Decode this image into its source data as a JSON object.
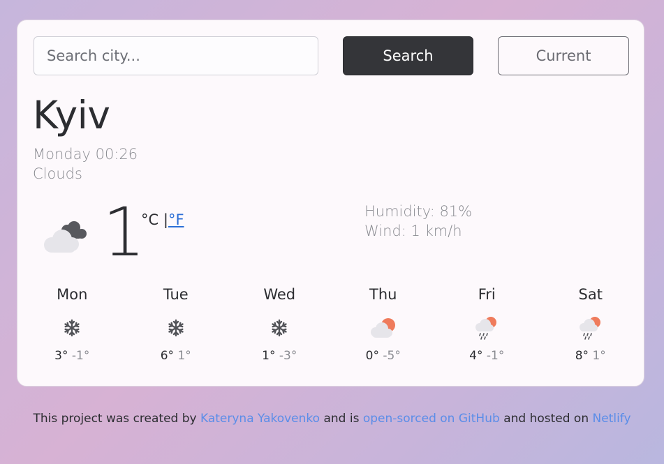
{
  "search": {
    "placeholder": "Search city...",
    "button_label": "Search",
    "current_label": "Current"
  },
  "weather": {
    "city": "Kyiv",
    "datetime": "Monday 00:26",
    "description": "Clouds",
    "icon": "broken-clouds-icon",
    "temperature": "1",
    "unit_celsius": "°C",
    "unit_separator": "|",
    "unit_fahrenheit": "°F",
    "humidity": "Humidity: 81%",
    "wind": "Wind: 1 km/h"
  },
  "forecast": [
    {
      "day": "Mon",
      "icon": "snow-icon",
      "max": "3°",
      "min": "-1°"
    },
    {
      "day": "Tue",
      "icon": "snow-icon",
      "max": "6°",
      "min": "1°"
    },
    {
      "day": "Wed",
      "icon": "snow-icon",
      "max": "1°",
      "min": "-3°"
    },
    {
      "day": "Thu",
      "icon": "partly-cloudy-icon",
      "max": "0°",
      "min": "-5°"
    },
    {
      "day": "Fri",
      "icon": "rain-sun-icon",
      "max": "4°",
      "min": "-1°"
    },
    {
      "day": "Sat",
      "icon": "rain-sun-icon",
      "max": "8°",
      "min": "1°"
    }
  ],
  "footer": {
    "text_1": "This project was created by",
    "author": "Kateryna Yakovenko",
    "text_2": "and is",
    "github_link": "open-sorced on GitHub",
    "text_3": "and hosted on",
    "netlify_link": "Netlify"
  },
  "colors": {
    "accent": "#5b8de8",
    "button_dark": "#343539",
    "sun": "#ef7b5c"
  }
}
